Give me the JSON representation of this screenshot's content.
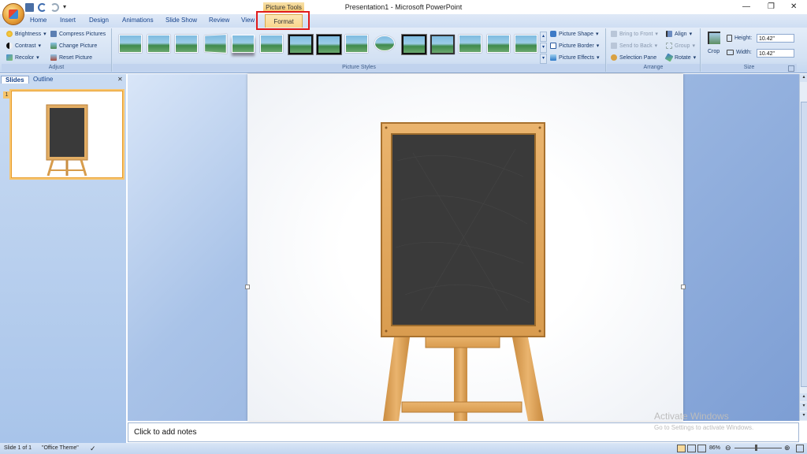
{
  "window": {
    "title": "Presentation1 - Microsoft PowerPoint",
    "context_label": "Picture Tools"
  },
  "tabs": [
    {
      "label": "Home"
    },
    {
      "label": "Insert"
    },
    {
      "label": "Design"
    },
    {
      "label": "Animations"
    },
    {
      "label": "Slide Show"
    },
    {
      "label": "Review"
    },
    {
      "label": "View"
    },
    {
      "label": "Format"
    }
  ],
  "adjust": {
    "label": "Adjust",
    "brightness": "Brightness",
    "contrast": "Contrast",
    "recolor": "Recolor",
    "compress": "Compress Pictures",
    "change": "Change Picture",
    "reset": "Reset Picture"
  },
  "styles": {
    "label": "Picture Styles",
    "shape": "Picture Shape",
    "border": "Picture Border",
    "effects": "Picture Effects"
  },
  "arrange": {
    "label": "Arrange",
    "bring_front": "Bring to Front",
    "send_back": "Send to Back",
    "selection_pane": "Selection Pane",
    "align": "Align",
    "group": "Group",
    "rotate": "Rotate"
  },
  "size": {
    "label": "Size",
    "crop": "Crop",
    "height_label": "Height:",
    "height_value": "10.42\"",
    "width_label": "Width:",
    "width_value": "10.42\""
  },
  "panel": {
    "slides_tab": "Slides",
    "outline_tab": "Outline",
    "slide_number": "1"
  },
  "notes": {
    "placeholder": "Click to add notes"
  },
  "status": {
    "slide": "Slide 1 of 1",
    "theme": "\"Office Theme\"",
    "zoom": "86%"
  },
  "watermark": {
    "line1": "Activate Windows",
    "line2": "Go to Settings to activate Windows."
  },
  "colors": {
    "highlight": "#e01b1b",
    "frame_wood": "#e2ad64",
    "board": "#3a3a3a"
  }
}
